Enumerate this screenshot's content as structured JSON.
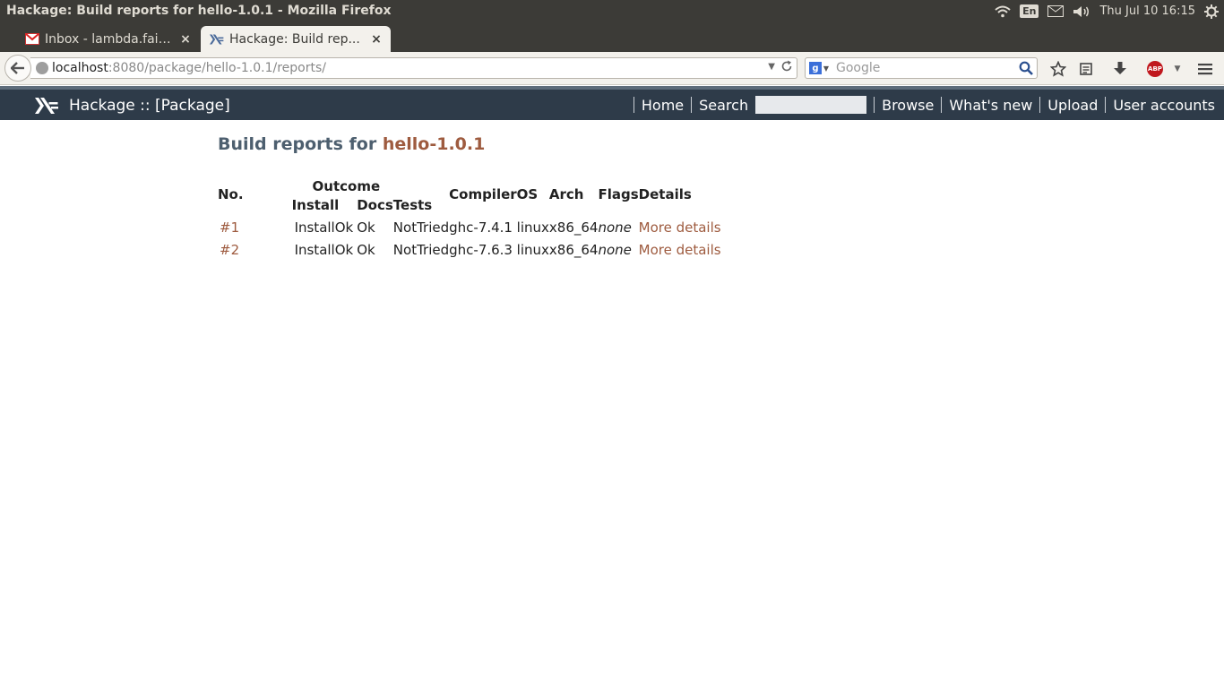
{
  "window": {
    "title": "Hackage: Build reports for hello-1.0.1 - Mozilla Firefox"
  },
  "tray": {
    "keyboard_layout": "En",
    "clock": "Thu Jul 10 16:15"
  },
  "tabs": [
    {
      "title": "Inbox - lambda.fairy...",
      "close": "×"
    },
    {
      "title": "Hackage: Build rep...",
      "close": "×"
    }
  ],
  "navbar": {
    "url_host": "localhost",
    "url_rest": ":8080/package/hello-1.0.1/reports/",
    "search_placeholder": "Google"
  },
  "hackage": {
    "brand": "Hackage :: [Package]",
    "nav": {
      "home": "Home",
      "search": "Search",
      "browse": "Browse",
      "whats_new": "What's new",
      "upload": "Upload",
      "user_accounts": "User accounts"
    }
  },
  "page": {
    "title_prefix": "Build reports for",
    "package": "hello-1.0.1"
  },
  "table": {
    "headers": {
      "no": "No.",
      "outcome": "Outcome",
      "install": "Install",
      "docs": "Docs",
      "tests": "Tests",
      "compiler": "Compiler",
      "os": "OS",
      "arch": "Arch",
      "flags": "Flags",
      "details": "Details"
    },
    "rows": [
      {
        "no": "#1",
        "install": "InstallOk",
        "docs": "Ok",
        "tests": "NotTried",
        "compiler": "ghc-7.4.1",
        "os": "linux",
        "arch": "x86_64",
        "flags": "none",
        "details": "More details"
      },
      {
        "no": "#2",
        "install": "InstallOk",
        "docs": "Ok",
        "tests": "NotTried",
        "compiler": "ghc-7.6.3",
        "os": "linux",
        "arch": "x86_64",
        "flags": "none",
        "details": "More details"
      }
    ]
  },
  "colors": {
    "hackage_header": "#2e3b49",
    "link": "#9e5b3f",
    "title": "#4d5f6f"
  }
}
